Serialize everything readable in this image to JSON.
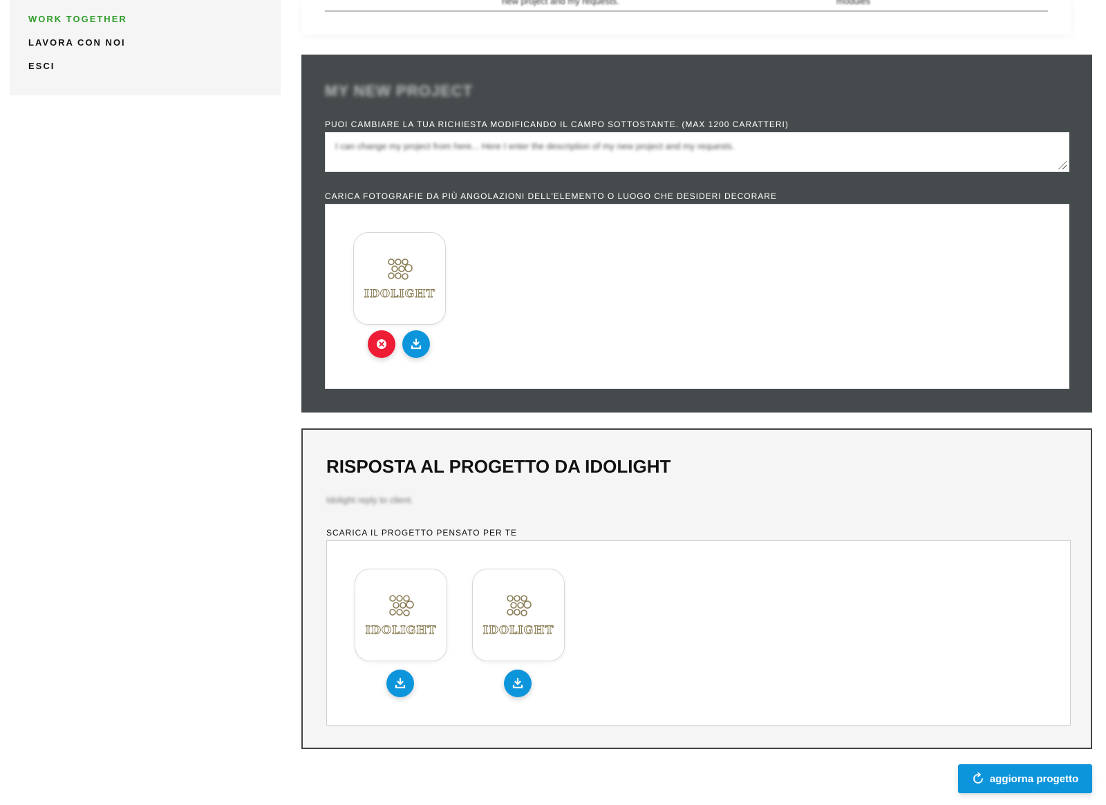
{
  "sidebar": {
    "items": [
      {
        "label": "WORK TOGETHER"
      },
      {
        "label": "LAVORA CON NOI"
      },
      {
        "label": "ESCI"
      }
    ]
  },
  "top_table": {
    "cells": [
      "new project and my requests.",
      "modules"
    ]
  },
  "project": {
    "title": "MY NEW PROJECT",
    "description_label": "PUOI CAMBIARE LA TUA RICHIESTA MODIFICANDO IL CAMPO SOTTOSTANTE. (MAX 1200 CARATTERI)",
    "description_value": "I can change my project from here...  Here I enter the description of my new project and my requests.",
    "photos_label": "CARICA FOTOGRAFIE DA PIÙ ANGOLAZIONI DELL'ELEMENTO O LUOGO CHE DESIDERI DECORARE",
    "photos": [
      {
        "brand": "IDOLIGHT"
      }
    ]
  },
  "response": {
    "title": "RISPOSTA AL PROGETTO DA IDOLIGHT",
    "text": "Idolight reply to client.",
    "download_label": "SCARICA IL PROGETTO PENSATO PER TE",
    "files": [
      {
        "brand": "IDOLIGHT"
      },
      {
        "brand": "IDOLIGHT"
      }
    ]
  },
  "update_button": {
    "label": "aggiorna progetto"
  },
  "colors": {
    "active_nav": "#2f9e2a",
    "panel_dark": "#454b4c",
    "accent_blue": "#0d95dc",
    "danger_red": "#ee1c35"
  },
  "icons": {
    "delete": "close-circle-icon",
    "download": "download-icon",
    "refresh": "refresh-icon",
    "logo": "idolight-logo"
  }
}
